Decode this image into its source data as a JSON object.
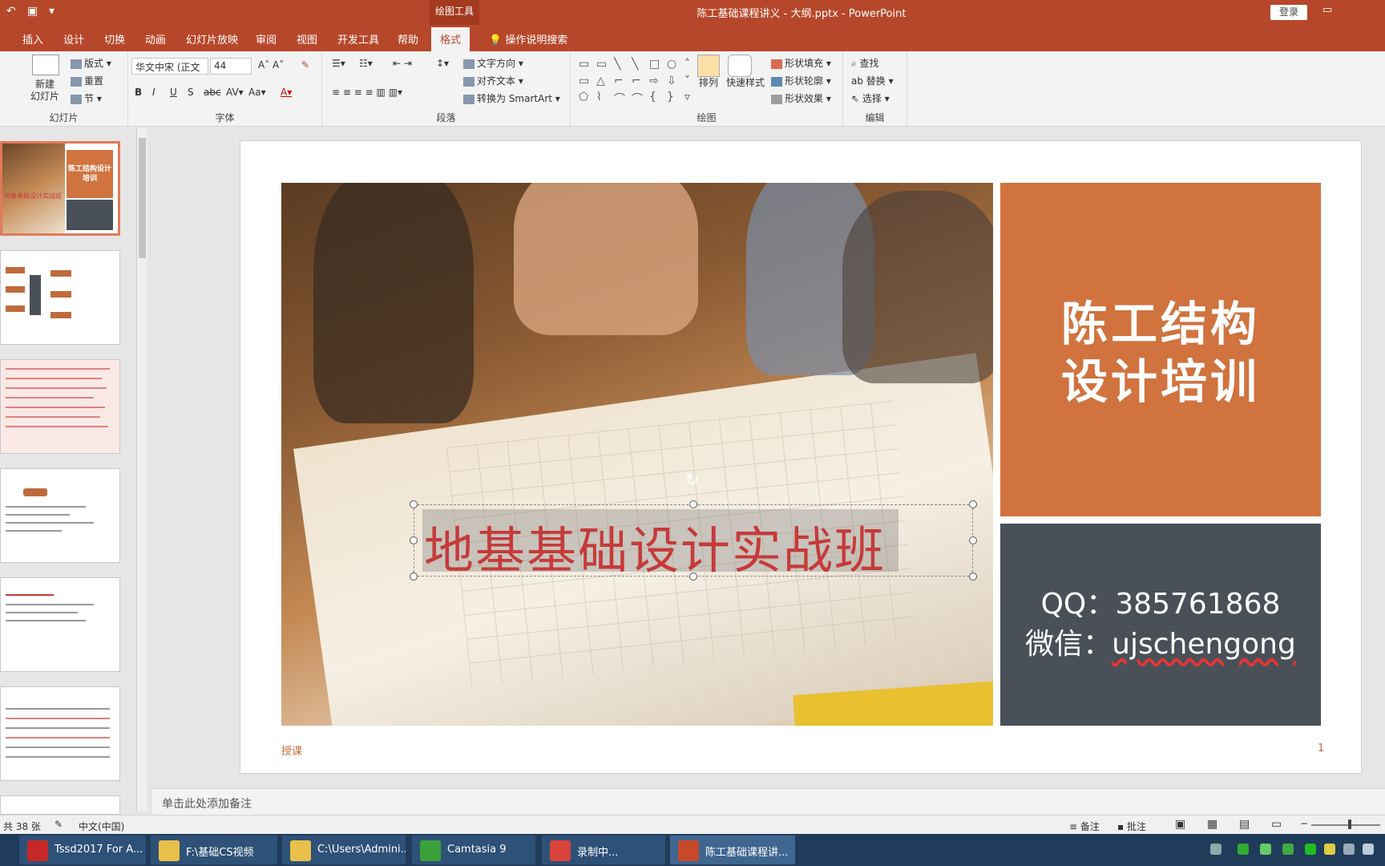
{
  "titlebar": {
    "context_tab": "绘图工具",
    "document_title": "陈工基础课程讲义 - 大纲.pptx  -  PowerPoint",
    "login": "登录"
  },
  "tabs": [
    {
      "label": "插入"
    },
    {
      "label": "设计"
    },
    {
      "label": "切换"
    },
    {
      "label": "动画"
    },
    {
      "label": "幻灯片放映"
    },
    {
      "label": "审阅"
    },
    {
      "label": "视图"
    },
    {
      "label": "开发工具"
    },
    {
      "label": "帮助"
    },
    {
      "label": "格式"
    }
  ],
  "tell_me": "操作说明搜索",
  "ribbon": {
    "slides": {
      "new_slide": "新建\n幻灯片",
      "layout": "版式",
      "reset": "重置",
      "section": "节",
      "label": "幻灯片"
    },
    "font": {
      "name": "华文中宋 (正文",
      "size": "44",
      "label": "字体"
    },
    "paragraph": {
      "text_direction": "文字方向",
      "align_text": "对齐文本",
      "smartart": "转换为 SmartArt",
      "label": "段落"
    },
    "drawing": {
      "arrange": "排列",
      "quick_styles": "快速样式",
      "shape_fill": "形状填充",
      "shape_outline": "形状轮廓",
      "shape_effects": "形状效果",
      "label": "绘图"
    },
    "editing": {
      "find": "查找",
      "replace": "替换",
      "select": "选择",
      "label": "编辑"
    }
  },
  "slide": {
    "title_block": "陈工结构\n设计培训",
    "qq": "QQ：385761868",
    "wechat_prefix": "微信：",
    "wechat_id": "ujschengong",
    "headline": "地基基础设计实战班",
    "footer_left": "授课",
    "page_number": "1"
  },
  "thumbs": {
    "slide1_title": "陈工结构设计培训",
    "slide1_sub": "地基基础设计实战班"
  },
  "notes_placeholder": "单击此处添加备注",
  "status": {
    "slide_count": "共 38 张",
    "language": "中文(中国)",
    "notes": "备注",
    "comments": "批注"
  },
  "taskbar": [
    {
      "label": "Tssd2017 For A...",
      "color": "#c62828"
    },
    {
      "label": "F:\\基础CS视频",
      "color": "#e8c04a"
    },
    {
      "label": "C:\\Users\\Admini...",
      "color": "#e8c04a"
    },
    {
      "label": "Camtasia 9",
      "color": "#3aa13a"
    },
    {
      "label": "录制中...",
      "color": "#d8433a"
    },
    {
      "label": "陈工基础课程讲...",
      "color": "#c8482a"
    }
  ]
}
